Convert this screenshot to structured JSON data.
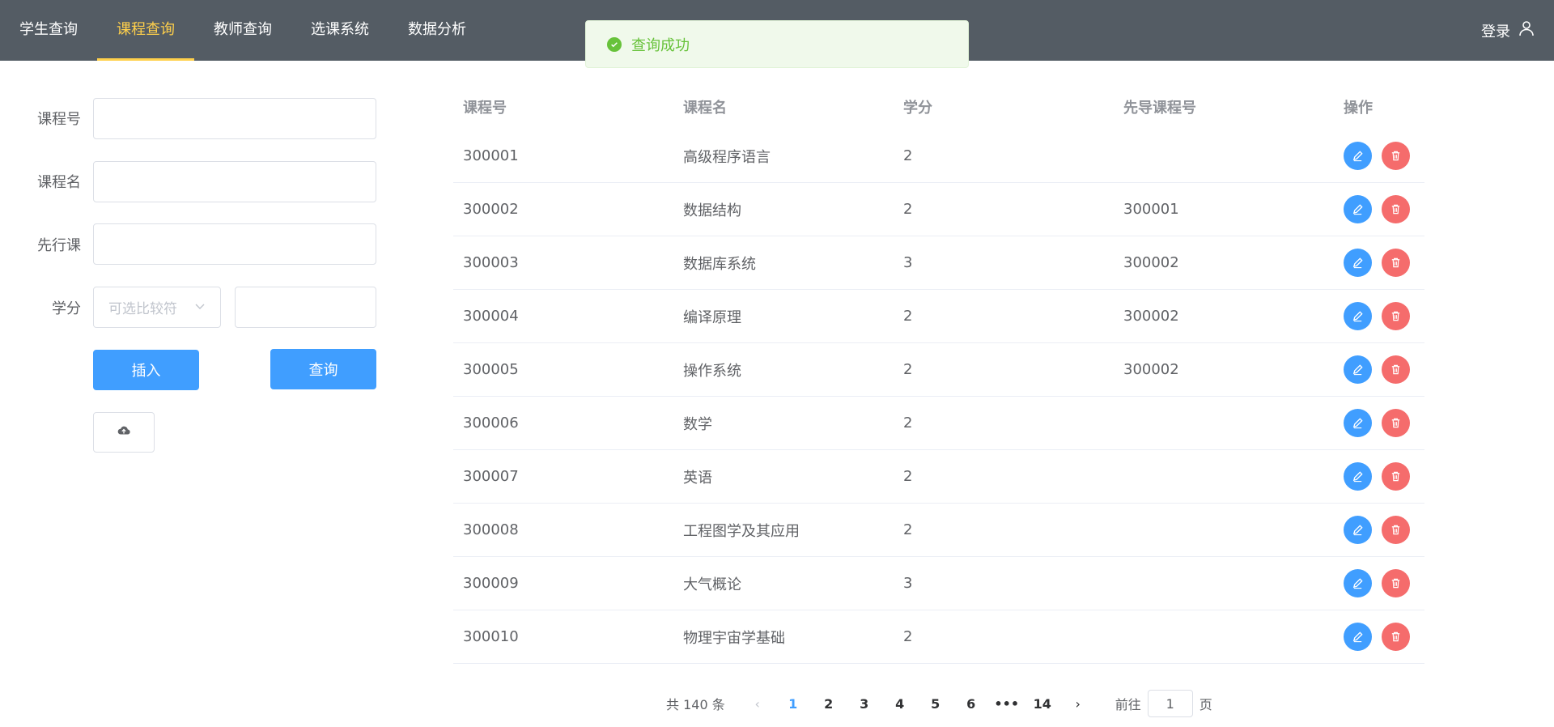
{
  "nav": {
    "items": [
      {
        "label": "学生查询"
      },
      {
        "label": "课程查询"
      },
      {
        "label": "教师查询"
      },
      {
        "label": "选课系统"
      },
      {
        "label": "数据分析"
      }
    ],
    "active_index": 1,
    "login_label": "登录"
  },
  "toast": {
    "message": "查询成功"
  },
  "form": {
    "course_id_label": "课程号",
    "course_id_value": "",
    "course_name_label": "课程名",
    "course_name_value": "",
    "prereq_label": "先行课",
    "prereq_value": "",
    "credit_label": "学分",
    "credit_compare_placeholder": "可选比较符",
    "credit_value": "",
    "insert_label": "插入",
    "query_label": "查询"
  },
  "table": {
    "headers": [
      "课程号",
      "课程名",
      "学分",
      "先导课程号",
      "操作"
    ],
    "rows": [
      {
        "id": "300001",
        "name": "高级程序语言",
        "credit": "2",
        "prereq": ""
      },
      {
        "id": "300002",
        "name": "数据结构",
        "credit": "2",
        "prereq": "300001"
      },
      {
        "id": "300003",
        "name": "数据库系统",
        "credit": "3",
        "prereq": "300002"
      },
      {
        "id": "300004",
        "name": "编译原理",
        "credit": "2",
        "prereq": "300002"
      },
      {
        "id": "300005",
        "name": "操作系统",
        "credit": "2",
        "prereq": "300002"
      },
      {
        "id": "300006",
        "name": "数学",
        "credit": "2",
        "prereq": ""
      },
      {
        "id": "300007",
        "name": "英语",
        "credit": "2",
        "prereq": ""
      },
      {
        "id": "300008",
        "name": "工程图学及其应用",
        "credit": "2",
        "prereq": ""
      },
      {
        "id": "300009",
        "name": "大气概论",
        "credit": "3",
        "prereq": ""
      },
      {
        "id": "300010",
        "name": "物理宇宙学基础",
        "credit": "2",
        "prereq": ""
      }
    ]
  },
  "pagination": {
    "total_label": "共 140 条",
    "pages": [
      "1",
      "2",
      "3",
      "4",
      "5",
      "6",
      "•••",
      "14"
    ],
    "current": "1",
    "goto_prefix": "前往",
    "goto_value": "1",
    "goto_suffix": "页"
  },
  "colors": {
    "primary": "#409eff",
    "danger": "#f56c6c",
    "nav_bg": "#545c64",
    "nav_active": "#ffd04b",
    "success": "#67c23a"
  }
}
